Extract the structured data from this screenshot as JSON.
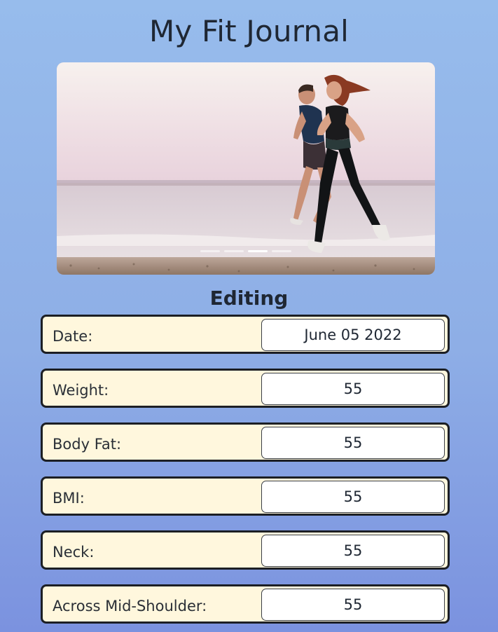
{
  "app": {
    "title": "My Fit Journal"
  },
  "carousel": {
    "image_description_icon": "photo-couple-jogging-beach",
    "slide_count": 4,
    "active_slide": 3
  },
  "form": {
    "heading": "Editing",
    "fields": [
      {
        "label": "Date:",
        "value": "June 05 2022"
      },
      {
        "label": "Weight:",
        "value": "55"
      },
      {
        "label": "Body Fat:",
        "value": "55"
      },
      {
        "label": "BMI:",
        "value": "55"
      },
      {
        "label": "Neck:",
        "value": "55"
      },
      {
        "label": "Across Mid-Shoulder:",
        "value": "55"
      }
    ]
  },
  "colors": {
    "background_top": "#97bcec",
    "background_bottom": "#7b92df",
    "row_background": "#fff7dd",
    "row_border": "#1c1f24",
    "input_background": "#ffffff"
  }
}
